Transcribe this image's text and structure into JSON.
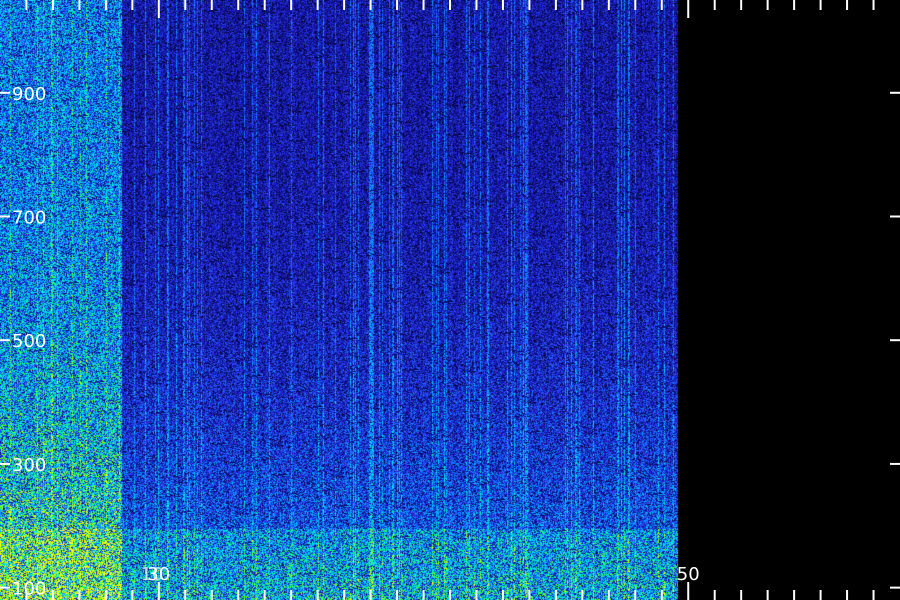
{
  "chart_data": {
    "type": "heatmap",
    "title": "",
    "xlabel": "",
    "ylabel": "",
    "xlim": [
      24,
      58
    ],
    "ylim": [
      80,
      1050
    ],
    "data_x_extent": [
      24,
      49.6
    ],
    "x_ticks_major": [
      30,
      50
    ],
    "x_ticks_minor": [
      25,
      26,
      27,
      28,
      29,
      31,
      32,
      33,
      34,
      35,
      36,
      37,
      38,
      39,
      40,
      41,
      42,
      43,
      44,
      45,
      46,
      47,
      48,
      49,
      51,
      52,
      53,
      54,
      55,
      56,
      57
    ],
    "x_tick_labels_visible": [
      "30",
      "50"
    ],
    "x_tick_labels_covered": [
      "10"
    ],
    "y_ticks": [
      100,
      300,
      500,
      700,
      900
    ],
    "y_tick_labels": [
      "100",
      "300",
      "500",
      "700",
      "900"
    ],
    "colormap": [
      "#000000",
      "#0a0a6e",
      "#1e1ec8",
      "#2850ff",
      "#00a0ff",
      "#00e6ff",
      "#00ff80",
      "#80ff00",
      "#ffff00"
    ],
    "bands": [
      {
        "x_range": [
          24,
          28.6
        ],
        "description": "strong emission",
        "level_low_freq": 0.95,
        "level_high_freq": 0.55
      },
      {
        "x_range": [
          28.6,
          49.6
        ],
        "description": "weak emission",
        "level_low_freq": 0.55,
        "level_high_freq": 0.25
      }
    ],
    "grid": false,
    "legend": "none"
  }
}
